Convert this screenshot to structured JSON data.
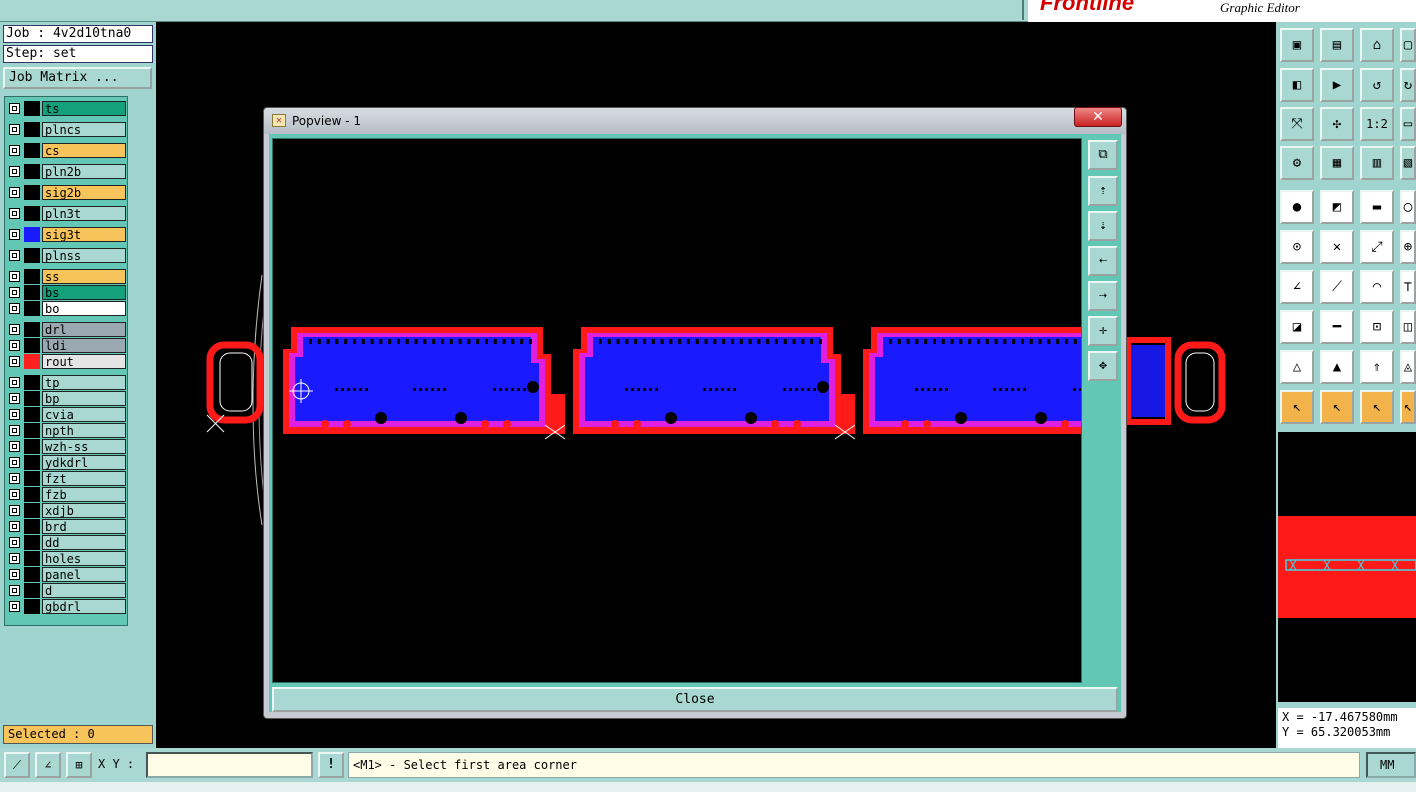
{
  "app": {
    "logo_text": "Frontline",
    "subtitle": "Graphic Editor"
  },
  "left": {
    "job_label": "Job : 4v2d10tna0",
    "step_label": "Step: set",
    "job_matrix": "Job Matrix ...",
    "selected": "Selected : 0",
    "layers": [
      {
        "name": "ts",
        "color": "#13a07a",
        "swatch": "#000000"
      },
      {
        "name": "plncs",
        "color": "#a9d7d2",
        "swatch": "#000000"
      },
      {
        "name": "cs",
        "color": "#f7c45c",
        "swatch": "#000000"
      },
      {
        "name": "pln2b",
        "color": "#a9d7d2",
        "swatch": "#000000"
      },
      {
        "name": "sig2b",
        "color": "#f7c45c",
        "swatch": "#000000"
      },
      {
        "name": "pln3t",
        "color": "#a9d7d2",
        "swatch": "#000000"
      },
      {
        "name": "sig3t",
        "color": "#f7c45c",
        "swatch": "#1a1aff"
      },
      {
        "name": "plnss",
        "color": "#a9d7d2",
        "swatch": "#000000"
      },
      {
        "name": "ss",
        "color": "#f7c45c",
        "swatch": "#000000"
      },
      {
        "name": "bs",
        "color": "#13a07a",
        "swatch": "#000000"
      },
      {
        "name": "bo",
        "color": "#ffffff",
        "swatch": "#000000"
      },
      {
        "name": "drl",
        "color": "#9aa9b1",
        "swatch": "#000000"
      },
      {
        "name": "ldi",
        "color": "#9aa9b1",
        "swatch": "#000000"
      },
      {
        "name": "rout",
        "color": "#e5e5e5",
        "swatch": "#ff2020"
      },
      {
        "name": "tp",
        "color": "#a9d7d2",
        "swatch": "#000000"
      },
      {
        "name": "bp",
        "color": "#a9d7d2",
        "swatch": "#000000"
      },
      {
        "name": "cvia",
        "color": "#a9d7d2",
        "swatch": "#000000"
      },
      {
        "name": "npth",
        "color": "#a9d7d2",
        "swatch": "#000000"
      },
      {
        "name": "wzh-ss",
        "color": "#a9d7d2",
        "swatch": "#000000"
      },
      {
        "name": "ydkdrl",
        "color": "#a9d7d2",
        "swatch": "#000000"
      },
      {
        "name": "fzt",
        "color": "#a9d7d2",
        "swatch": "#000000"
      },
      {
        "name": "fzb",
        "color": "#a9d7d2",
        "swatch": "#000000"
      },
      {
        "name": "xdjb",
        "color": "#a9d7d2",
        "swatch": "#000000"
      },
      {
        "name": "brd",
        "color": "#a9d7d2",
        "swatch": "#000000"
      },
      {
        "name": "dd",
        "color": "#a9d7d2",
        "swatch": "#000000"
      },
      {
        "name": "holes",
        "color": "#a9d7d2",
        "swatch": "#000000"
      },
      {
        "name": "panel",
        "color": "#a9d7d2",
        "swatch": "#000000"
      },
      {
        "name": "d",
        "color": "#a9d7d2",
        "swatch": "#000000"
      },
      {
        "name": "gbdrl",
        "color": "#a9d7d2",
        "swatch": "#000000"
      }
    ]
  },
  "popup": {
    "title": "Popview - 1",
    "close_x": "✕",
    "close_button": "Close"
  },
  "right": {
    "zoom_ratio_label": "1:2",
    "coord_x": "X = -17.467580mm",
    "coord_y": "Y = 65.320053mm"
  },
  "bottom": {
    "xy_label": "X Y :",
    "xy_value": "",
    "bang": "!",
    "prompt": "<M1> - Select first area corner",
    "units": "MM"
  },
  "colors": {
    "panel_bg": "#9fd4cf",
    "copper_blue": "#1a1aff",
    "rout_red": "#ff1a1a",
    "mask_magenta": "#e020e0"
  }
}
